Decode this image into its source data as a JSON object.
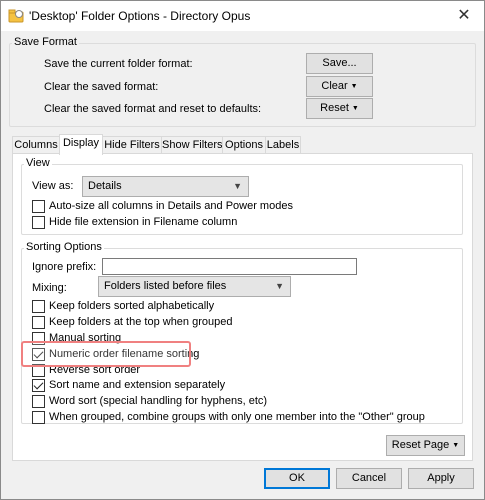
{
  "window": {
    "title": "'Desktop' Folder Options - Directory Opus"
  },
  "save_format": {
    "group_label": "Save Format",
    "rows": [
      {
        "label": "Save the current folder format:",
        "button": "Save..."
      },
      {
        "label": "Clear the saved format:",
        "button": "Clear"
      },
      {
        "label": "Clear the saved format and reset to defaults:",
        "button": "Reset"
      }
    ]
  },
  "tabs": [
    "Columns",
    "Display",
    "Hide Filters",
    "Show Filters",
    "Options",
    "Labels"
  ],
  "active_tab": "Display",
  "view": {
    "group_label": "View",
    "view_as_label": "View as:",
    "view_as_value": "Details",
    "checkboxes": [
      {
        "label": "Auto-size all columns in Details and Power modes",
        "checked": false
      },
      {
        "label": "Hide file extension in Filename column",
        "checked": false
      }
    ]
  },
  "sorting": {
    "group_label": "Sorting Options",
    "ignore_prefix_label": "Ignore prefix:",
    "ignore_prefix_value": "",
    "mixing_label": "Mixing:",
    "mixing_value": "Folders listed before files",
    "checkboxes": [
      {
        "label": "Keep folders sorted alphabetically",
        "checked": false
      },
      {
        "label": "Keep folders at the top when grouped",
        "checked": false
      },
      {
        "label": "Manual sorting",
        "checked": false
      },
      {
        "label": "Numeric order filename sorting",
        "checked": true
      },
      {
        "label": "Reverse sort order",
        "checked": false
      },
      {
        "label": "Sort name and extension separately",
        "checked": true
      },
      {
        "label": "Word sort (special handling for hyphens, etc)",
        "checked": false
      },
      {
        "label": "When grouped, combine groups with only one member into the \"Other\" group",
        "checked": false
      }
    ]
  },
  "footer": {
    "reset_page": "Reset Page",
    "ok": "OK",
    "cancel": "Cancel",
    "apply": "Apply"
  },
  "colors": {
    "highlight": "#f08080",
    "accent": "#0078d7"
  }
}
